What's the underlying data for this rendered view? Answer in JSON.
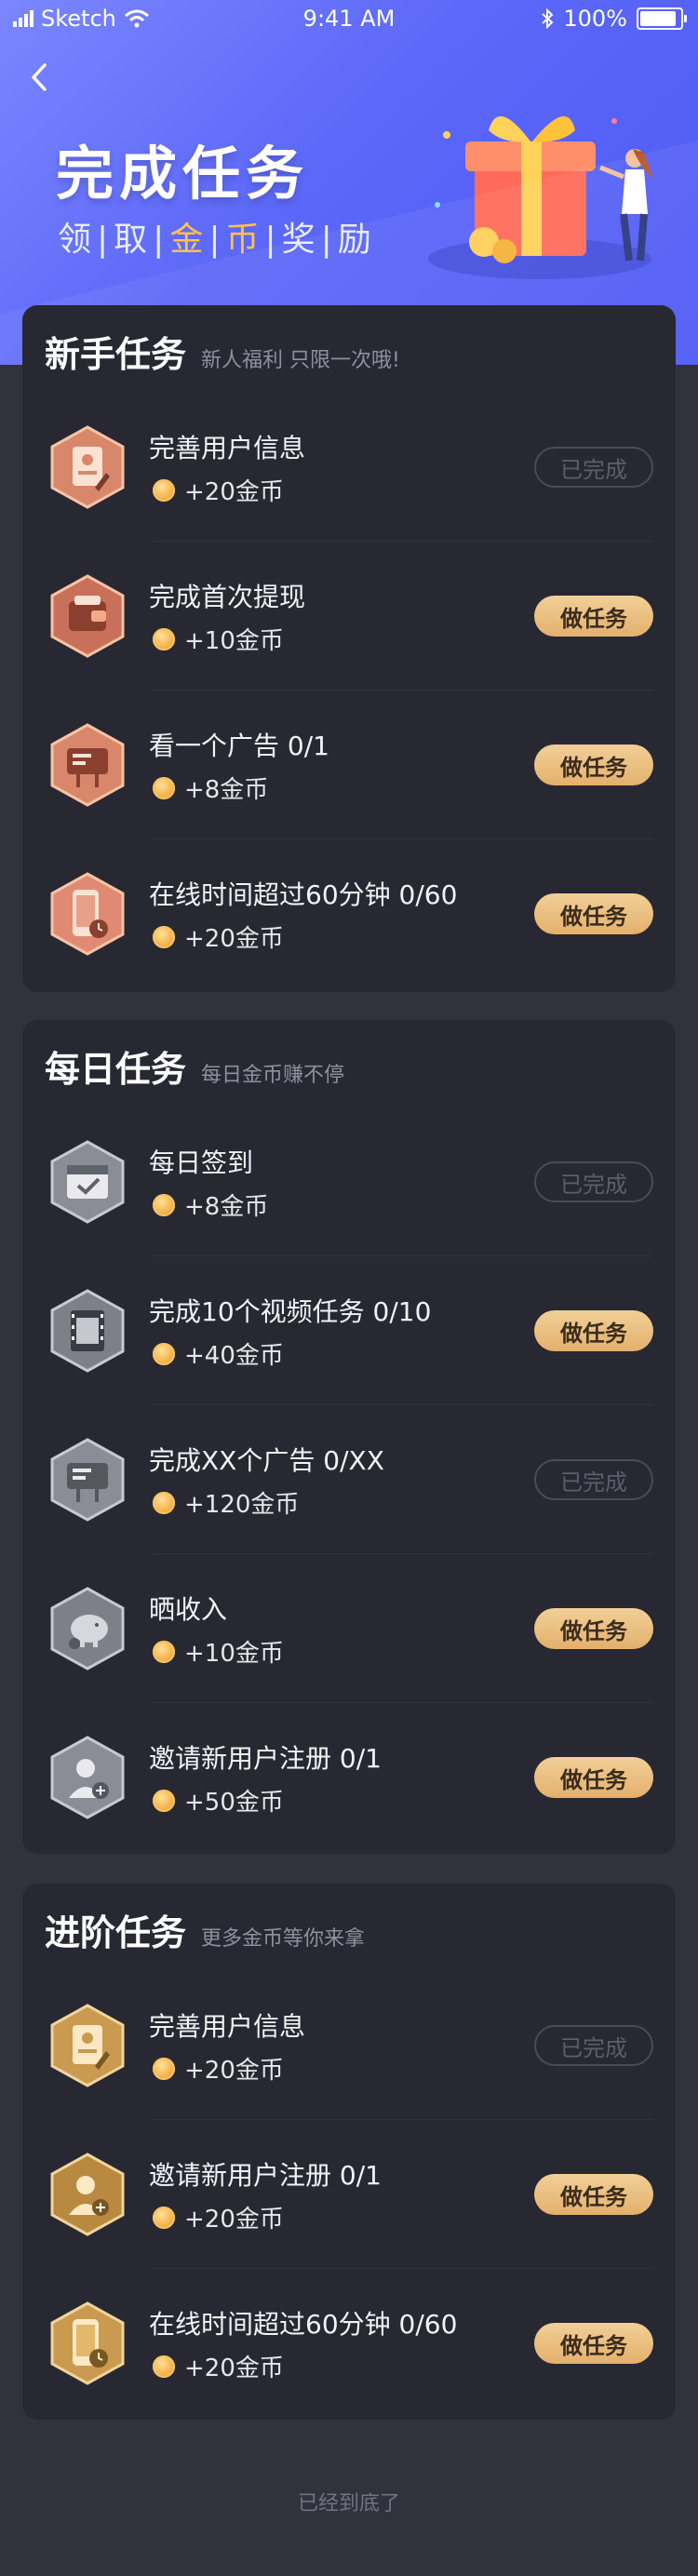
{
  "status_bar": {
    "carrier": "Sketch",
    "time": "9:41 AM",
    "battery": "100%"
  },
  "header": {
    "title": "完成任务",
    "subtitle_parts": [
      "领",
      "取",
      "金",
      "币",
      "奖",
      "励"
    ]
  },
  "colors": {
    "accent": "#e9b978",
    "card": "#272832",
    "page": "#31323c",
    "hero": "#5c68f8"
  },
  "sections": [
    {
      "title": "新手任务",
      "subtitle": "新人福利 只限一次哦!",
      "tasks": [
        {
          "name": "完善用户信息",
          "reward": "+20金币",
          "status": "已完成",
          "icon": "profile-card-icon"
        },
        {
          "name": "完成首次提现",
          "reward": "+10金币",
          "status": "做任务",
          "icon": "wallet-icon"
        },
        {
          "name": "看一个广告  0/1",
          "reward": "+8金币",
          "status": "做任务",
          "icon": "billboard-icon"
        },
        {
          "name": "在线时间超过60分钟  0/60",
          "reward": "+20金币",
          "status": "做任务",
          "icon": "phone-clock-icon"
        }
      ]
    },
    {
      "title": "每日任务",
      "subtitle": "每日金币赚不停",
      "tasks": [
        {
          "name": "每日签到",
          "reward": "+8金币",
          "status": "已完成",
          "icon": "calendar-check-icon"
        },
        {
          "name": "完成10个视频任务  0/10",
          "reward": "+40金币",
          "status": "做任务",
          "icon": "film-icon"
        },
        {
          "name": "完成XX个广告  0/XX",
          "reward": "+120金币",
          "status": "已完成",
          "icon": "billboard-icon"
        },
        {
          "name": "晒收入",
          "reward": "+10金币",
          "status": "做任务",
          "icon": "piggy-bank-icon"
        },
        {
          "name": "邀请新用户注册  0/1",
          "reward": "+50金币",
          "status": "做任务",
          "icon": "add-user-icon"
        }
      ]
    },
    {
      "title": "进阶任务",
      "subtitle": "更多金币等你来拿",
      "tasks": [
        {
          "name": "完善用户信息",
          "reward": "+20金币",
          "status": "已完成",
          "icon": "profile-card-icon"
        },
        {
          "name": "邀请新用户注册  0/1",
          "reward": "+20金币",
          "status": "做任务",
          "icon": "add-user-icon"
        },
        {
          "name": "在线时间超过60分钟  0/60",
          "reward": "+20金币",
          "status": "做任务",
          "icon": "phone-clock-icon"
        }
      ]
    }
  ],
  "footer": "已经到底了"
}
